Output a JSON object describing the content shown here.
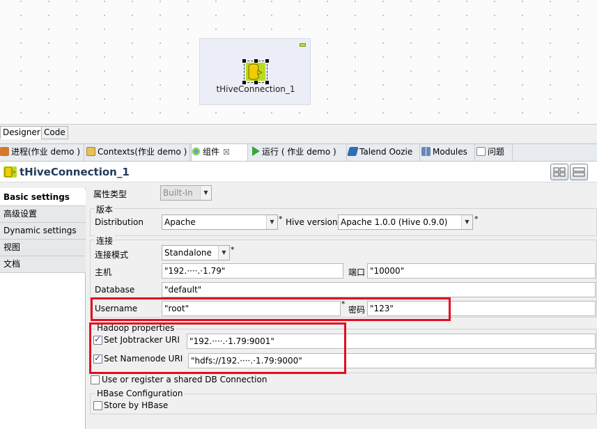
{
  "canvas": {
    "component_label": "tHiveConnection_1",
    "component_icon": "hive-connection-icon"
  },
  "editor_tabs": [
    {
      "label": "Designer"
    },
    {
      "label": "Code"
    }
  ],
  "view_tabs": [
    {
      "label": "进程(作业 demo )",
      "icon": "job-icon"
    },
    {
      "label": "Contexts(作业 demo )",
      "icon": "contexts-icon"
    },
    {
      "label": "组件",
      "icon": "component-icon",
      "close": "☒"
    },
    {
      "label": "运行 ( 作业 demo )",
      "icon": "run-icon"
    },
    {
      "label": "Talend Oozie",
      "icon": "oozie-icon"
    },
    {
      "label": "Modules",
      "icon": "modules-icon"
    },
    {
      "label": "问题",
      "icon": "problems-icon"
    }
  ],
  "title": "tHiveConnection_1",
  "side_nav": [
    {
      "label": "Basic settings",
      "active": true
    },
    {
      "label": "高级设置"
    },
    {
      "label": "Dynamic settings"
    },
    {
      "label": "视图"
    },
    {
      "label": "文档"
    }
  ],
  "form": {
    "property_type_label": "属性类型",
    "property_type_value": "Built-In",
    "version_group": "版本",
    "distribution_label": "Distribution",
    "distribution_value": "Apache",
    "hive_version_label": "Hive version",
    "hive_version_value": "Apache 1.0.0 (Hive 0.9.0)",
    "connection_group": "连接",
    "mode_label": "连接模式",
    "mode_value": "Standalone",
    "host_label": "主机",
    "host_value": "\"192.····.·1.79\"",
    "port_label": "端口",
    "port_value": "\"10000\"",
    "database_label": "Database",
    "database_value": "\"default\"",
    "username_label": "Username",
    "username_value": "\"root\"",
    "password_label": "密码",
    "password_value": "\"123\"",
    "hadoop_group": "Hadoop properties",
    "jobtracker_label": "Set Jobtracker URI",
    "jobtracker_value": "\"192.····.·1.79:9001\"",
    "namenode_label": "Set Namenode URI",
    "namenode_value": "\"hdfs://192.····.·1.79:9000\"",
    "shared_db_label": "Use or register a shared DB Connection",
    "hbase_group": "HBase Configuration",
    "store_hbase_label": "Store by HBase",
    "required_mark": "*"
  },
  "colors": {
    "highlight_box": "#e30d1f",
    "title_text": "#223a5a",
    "component_green": "#b9dd1c"
  }
}
